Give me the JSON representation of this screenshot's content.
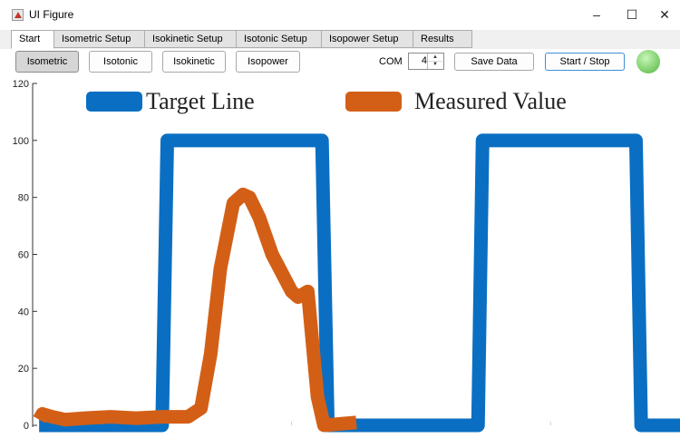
{
  "window": {
    "title": "UI Figure",
    "icon": "matlab-figure-icon"
  },
  "window_controls": {
    "minimize": "–",
    "maximize": "☐",
    "close": "✕"
  },
  "tabs": [
    {
      "label": "Start",
      "active": true
    },
    {
      "label": "Isometric Setup",
      "active": false
    },
    {
      "label": "Isokinetic Setup",
      "active": false
    },
    {
      "label": "Isotonic Setup",
      "active": false
    },
    {
      "label": "Isopower Setup",
      "active": false
    },
    {
      "label": "Results",
      "active": false
    }
  ],
  "toolbar": {
    "mode_buttons": [
      {
        "label": "Isometric",
        "pressed": true
      },
      {
        "label": "Isotonic",
        "pressed": false
      },
      {
        "label": "Isokinetic",
        "pressed": false
      },
      {
        "label": "Isopower",
        "pressed": false
      }
    ],
    "com_label": "COM",
    "com_value": "4",
    "save_label": "Save Data",
    "start_stop_label": "Start / Stop",
    "status_lamp_color": "#7fd06c"
  },
  "chart_data": {
    "type": "line",
    "ylim": [
      0,
      120
    ],
    "xlim": [
      0,
      100
    ],
    "yticks": [
      0,
      20,
      40,
      60,
      80,
      100,
      120
    ],
    "legend_position": "top",
    "series": [
      {
        "name": "Target Line",
        "color": "#0a6fc2",
        "x": [
          1,
          20,
          20.8,
          44.7,
          45.6,
          68.8,
          69.5,
          93.2,
          94,
          100
        ],
        "y": [
          0,
          0,
          100,
          100,
          0,
          0,
          100,
          100,
          0,
          0
        ]
      },
      {
        "name": "Measured Value",
        "color": "#d35f17",
        "x": [
          1,
          1.5,
          3,
          5,
          8,
          12,
          16,
          20,
          24,
          26,
          27.5,
          29,
          31,
          32.5,
          33.5,
          35,
          37,
          40,
          41,
          42.5,
          44,
          45,
          50
        ],
        "y": [
          2,
          4,
          3,
          2,
          2.5,
          3,
          2.5,
          3,
          3,
          6,
          25,
          55,
          78,
          81,
          80,
          73,
          60,
          47,
          45,
          47,
          10,
          0,
          1
        ]
      }
    ]
  }
}
